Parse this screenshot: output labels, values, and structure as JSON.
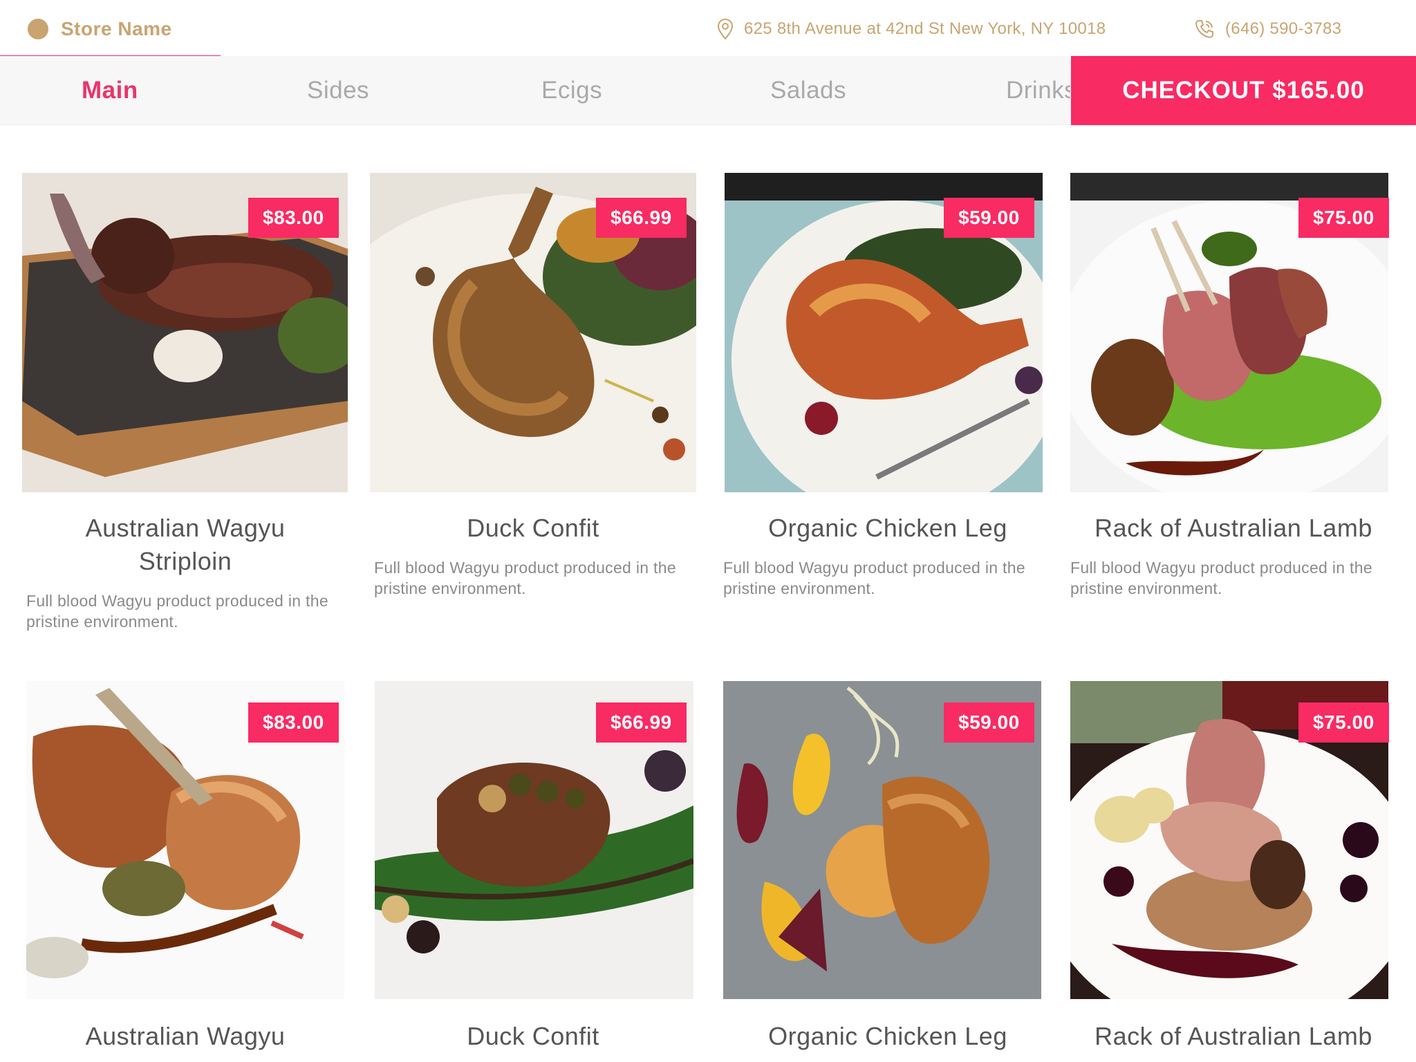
{
  "header": {
    "store_name": "Store Name",
    "address": "625 8th Avenue at 42nd St New York, NY 10018",
    "phone": "(646) 590-3783"
  },
  "tabs": [
    {
      "label": "Main",
      "active": true
    },
    {
      "label": "Sides",
      "active": false
    },
    {
      "label": "Ecigs",
      "active": false
    },
    {
      "label": "Salads",
      "active": false
    },
    {
      "label": "Drinks",
      "active": false
    }
  ],
  "checkout": {
    "label": "CHECKOUT $165.00"
  },
  "colors": {
    "accent": "#f82b63",
    "brand": "#c9a470",
    "active_tab": "#e9356a"
  },
  "products": [
    {
      "name": "Australian Wagyu Striploin",
      "price": "$83.00",
      "description": "Full blood Wagyu product produced in the pristine environment."
    },
    {
      "name": "Duck Confit",
      "price": "$66.99",
      "description": "Full blood Wagyu product produced in the pristine environment."
    },
    {
      "name": "Organic Chicken Leg",
      "price": "$59.00",
      "description": "Full blood Wagyu product produced in the pristine environment."
    },
    {
      "name": "Rack of Australian Lamb",
      "price": "$75.00",
      "description": "Full blood Wagyu product produced in the pristine environment."
    },
    {
      "name": "Australian Wagyu",
      "price": "$83.00"
    },
    {
      "name": "Duck Confit",
      "price": "$66.99"
    },
    {
      "name": "Organic Chicken Leg",
      "price": "$59.00"
    },
    {
      "name": "Rack of Australian Lamb",
      "price": "$75.00"
    }
  ]
}
